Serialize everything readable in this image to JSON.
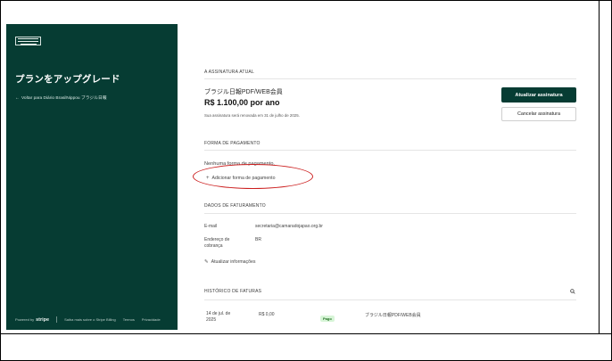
{
  "sidebar": {
    "title": "プランをアップグレード",
    "back_link": "Voltar para Diário BrasilNippou ブラジル日報",
    "footer": {
      "powered_by": "Powered by",
      "stripe": "stripe",
      "links": [
        "Saiba mais sobre o Stripe Billing",
        "Termos",
        "Privacidade"
      ]
    }
  },
  "subscription": {
    "section_title": "A ASSINATURA ATUAL",
    "plan_name": "ブラジル日報PDF/WEB会員",
    "price": "R$ 1.100,00 por ano",
    "renewal": "Sua assinatura será renovada em 31 de julho de 2025.",
    "update_button": "Atualizar assinatura",
    "cancel_button": "Cancelar assinatura"
  },
  "payment": {
    "section_title": "FORMA DE PAGAMENTO",
    "empty_text": "Nenhuma forma de pagamento.",
    "add_link": "Adicionar forma de pagamento",
    "highlight_color": "#cc1f1f"
  },
  "billing": {
    "section_title": "DADOS DE FATURAMENTO",
    "email_label": "E-mail",
    "email_value": "secretaria@camaradojapao.org.br",
    "address_label": "Endereço de cobrança",
    "address_value": "BR",
    "update_link": "Atualizar informações"
  },
  "invoices": {
    "section_title": "HISTÓRICO DE FATURAS",
    "rows": [
      {
        "date": "14 de jul. de 2025",
        "amount": "R$ 0,00",
        "status": "Pago",
        "description": "ブラジル日報PDF/WEB会員"
      }
    ]
  },
  "colors": {
    "sidebar_bg": "#063c33",
    "primary_button": "#063c33",
    "paid_badge_bg": "#d7f5d7"
  }
}
